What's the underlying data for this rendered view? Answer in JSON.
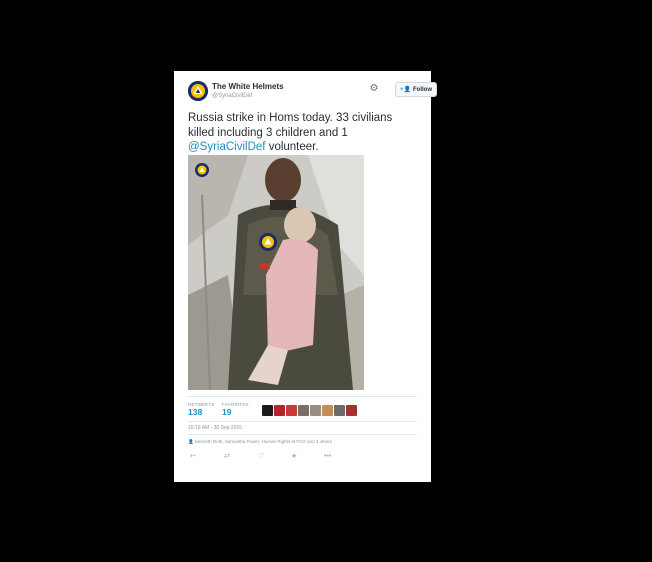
{
  "account": {
    "display_name": "The White Helmets",
    "handle": "@SyriaCivilDef"
  },
  "header": {
    "settings_icon": "gear-icon",
    "follow_label": "Follow",
    "follow_icon": "add-user-icon"
  },
  "tweet": {
    "text_before": "Russia strike in Homs today. 33 civilians killed including 3 children and 1 ",
    "mention": "@SyriaCivilDef",
    "text_after": " volunteer."
  },
  "stats": {
    "retweets_label": "RETWEETS",
    "retweets_value": "138",
    "favorites_label": "FAVORITES",
    "favorites_value": "19"
  },
  "timestamp": "10:19 AM - 30 Sep 2015",
  "tagged_line": "Kenneth Roth, Samantha Power, Human Rights at FCO and 3 others",
  "actions": {
    "reply_icon": "reply-icon",
    "retweet_icon": "retweet-icon",
    "favorite_icon": "heart-icon",
    "star_icon": "star-icon",
    "more_icon": "more-icon"
  },
  "colors": {
    "link": "#1f8ec2",
    "muted": "#8899a6",
    "background": "#000000"
  }
}
